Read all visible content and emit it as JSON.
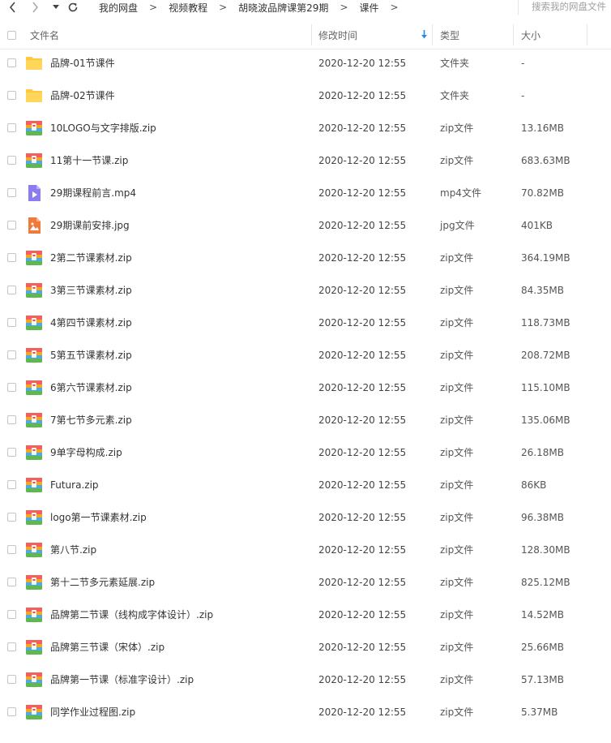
{
  "breadcrumb": [
    "我的网盘",
    "视频教程",
    "胡晓波品牌课第29期",
    "课件"
  ],
  "breadcrumb_separator": ">",
  "search": {
    "placeholder": "搜索我的网盘文件"
  },
  "columns": {
    "name": "文件名",
    "modified": "修改时间",
    "type": "类型",
    "size": "大小"
  },
  "colors": {
    "folder": "#FFC93C",
    "zip": "#6FBF5A",
    "mp4": "#8B7CF0",
    "jpg": "#F07A3A",
    "accent": "#2E88E8"
  },
  "files": [
    {
      "name": "品牌-01节课件",
      "modified": "2020-12-20 12:55",
      "type": "文件夹",
      "size": "-",
      "icon": "folder-icon"
    },
    {
      "name": "品牌-02节课件",
      "modified": "2020-12-20 12:55",
      "type": "文件夹",
      "size": "-",
      "icon": "folder-icon"
    },
    {
      "name": "10LOGO与文字排版.zip",
      "modified": "2020-12-20 12:55",
      "type": "zip文件",
      "size": "13.16MB",
      "icon": "zip-icon"
    },
    {
      "name": "11第十一节课.zip",
      "modified": "2020-12-20 12:55",
      "type": "zip文件",
      "size": "683.63MB",
      "icon": "zip-icon"
    },
    {
      "name": "29期课程前言.mp4",
      "modified": "2020-12-20 12:55",
      "type": "mp4文件",
      "size": "70.82MB",
      "icon": "video-icon"
    },
    {
      "name": "29期课前安排.jpg",
      "modified": "2020-12-20 12:55",
      "type": "jpg文件",
      "size": "401KB",
      "icon": "image-icon"
    },
    {
      "name": "2第二节课素材.zip",
      "modified": "2020-12-20 12:55",
      "type": "zip文件",
      "size": "364.19MB",
      "icon": "zip-icon"
    },
    {
      "name": "3第三节课素材.zip",
      "modified": "2020-12-20 12:55",
      "type": "zip文件",
      "size": "84.35MB",
      "icon": "zip-icon"
    },
    {
      "name": "4第四节课素材.zip",
      "modified": "2020-12-20 12:55",
      "type": "zip文件",
      "size": "118.73MB",
      "icon": "zip-icon"
    },
    {
      "name": "5第五节课素材.zip",
      "modified": "2020-12-20 12:55",
      "type": "zip文件",
      "size": "208.72MB",
      "icon": "zip-icon"
    },
    {
      "name": "6第六节课素材.zip",
      "modified": "2020-12-20 12:55",
      "type": "zip文件",
      "size": "115.10MB",
      "icon": "zip-icon"
    },
    {
      "name": "7第七节多元素.zip",
      "modified": "2020-12-20 12:55",
      "type": "zip文件",
      "size": "135.06MB",
      "icon": "zip-icon"
    },
    {
      "name": "9单字母构成.zip",
      "modified": "2020-12-20 12:55",
      "type": "zip文件",
      "size": "26.18MB",
      "icon": "zip-icon"
    },
    {
      "name": "Futura.zip",
      "modified": "2020-12-20 12:55",
      "type": "zip文件",
      "size": "86KB",
      "icon": "zip-icon"
    },
    {
      "name": "logo第一节课素材.zip",
      "modified": "2020-12-20 12:55",
      "type": "zip文件",
      "size": "96.38MB",
      "icon": "zip-icon"
    },
    {
      "name": "第八节.zip",
      "modified": "2020-12-20 12:55",
      "type": "zip文件",
      "size": "128.30MB",
      "icon": "zip-icon"
    },
    {
      "name": "第十二节多元素延展.zip",
      "modified": "2020-12-20 12:55",
      "type": "zip文件",
      "size": "825.12MB",
      "icon": "zip-icon"
    },
    {
      "name": "品牌第二节课（线构成字体设计）.zip",
      "modified": "2020-12-20 12:55",
      "type": "zip文件",
      "size": "14.52MB",
      "icon": "zip-icon"
    },
    {
      "name": "品牌第三节课（宋体）.zip",
      "modified": "2020-12-20 12:55",
      "type": "zip文件",
      "size": "25.66MB",
      "icon": "zip-icon"
    },
    {
      "name": "品牌第一节课（标准字设计）.zip",
      "modified": "2020-12-20 12:55",
      "type": "zip文件",
      "size": "57.13MB",
      "icon": "zip-icon"
    },
    {
      "name": "同学作业过程图.zip",
      "modified": "2020-12-20 12:55",
      "type": "zip文件",
      "size": "5.37MB",
      "icon": "zip-icon"
    }
  ]
}
